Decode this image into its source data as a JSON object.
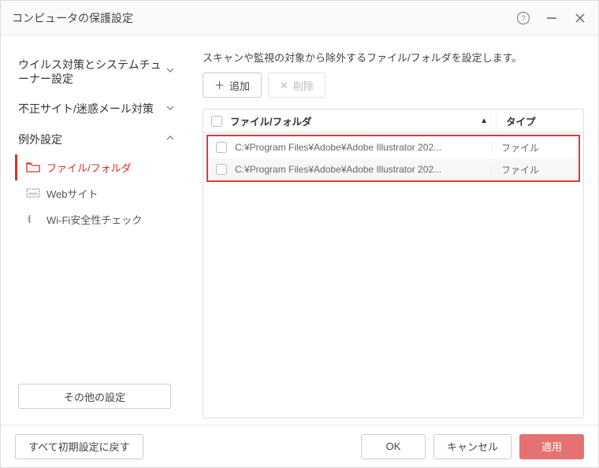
{
  "titlebar": {
    "title": "コンピュータの保護設定"
  },
  "sidebar": {
    "nav": [
      {
        "label": "ウイルス対策とシステムチューナー設定",
        "expanded": false
      },
      {
        "label": "不正サイト/迷惑メール対策",
        "expanded": false
      },
      {
        "label": "例外設定",
        "expanded": true
      }
    ],
    "sub_items": [
      {
        "label": "ファイル/フォルダ",
        "icon": "folder-icon",
        "active": true
      },
      {
        "label": "Webサイト",
        "icon": "www-icon",
        "active": false
      },
      {
        "label": "Wi-Fi安全性チェック",
        "icon": "wifi-icon",
        "active": false
      }
    ],
    "other_settings_label": "その他の設定"
  },
  "content": {
    "description": "スキャンや監視の対象から除外するファイル/フォルダを設定します。",
    "add_label": "追加",
    "delete_label": "削除",
    "columns": {
      "path": "ファイル/フォルダ",
      "type": "タイプ"
    },
    "rows": [
      {
        "path": "C:¥Program Files¥Adobe¥Adobe Illustrator 202...",
        "type": "ファイル"
      },
      {
        "path": "C:¥Program Files¥Adobe¥Adobe Illustrator 202...",
        "type": "ファイル"
      }
    ]
  },
  "footer": {
    "reset_label": "すべて初期設定に戻す",
    "ok_label": "OK",
    "cancel_label": "キャンセル",
    "apply_label": "適用"
  }
}
